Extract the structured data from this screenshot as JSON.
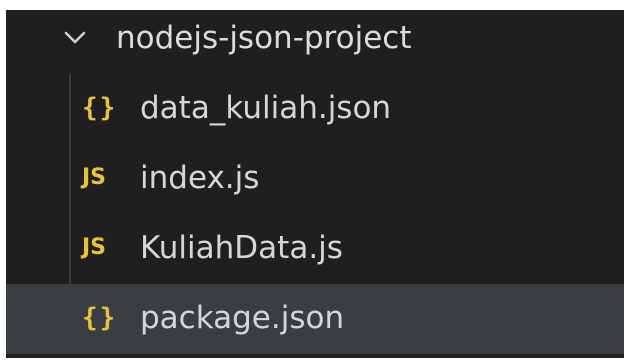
{
  "explorer": {
    "folder": {
      "name": "nodejs-json-project",
      "expanded": true,
      "icon": "chevron-down-icon"
    },
    "files": [
      {
        "name": "data_kuliah.json",
        "icon": "json-file-icon",
        "icon_text": "{}",
        "icon_color": "#e8c33a",
        "selected": false
      },
      {
        "name": "index.js",
        "icon": "js-file-icon",
        "icon_text": "JS",
        "icon_color": "#e8c33a",
        "selected": false
      },
      {
        "name": "KuliahData.js",
        "icon": "js-file-icon",
        "icon_text": "JS",
        "icon_color": "#e8c33a",
        "selected": false
      },
      {
        "name": "package.json",
        "icon": "json-file-icon",
        "icon_text": "{}",
        "icon_color": "#e8c33a",
        "selected": true
      }
    ],
    "colors": {
      "background": "#1f1f1f",
      "selected_row": "#3a3d41",
      "text": "#d6d6d6",
      "icon_accent": "#e8c33a"
    }
  }
}
